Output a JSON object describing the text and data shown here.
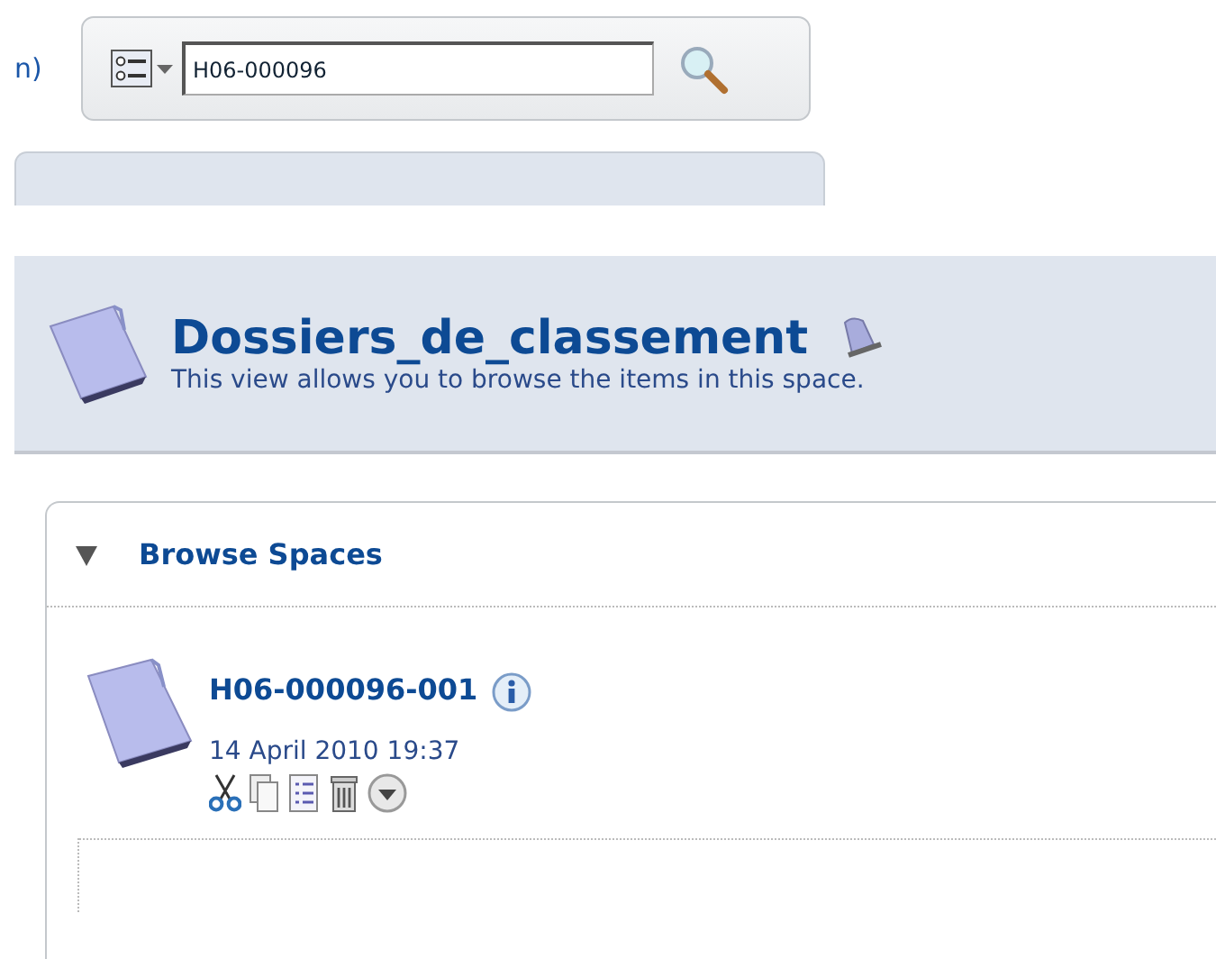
{
  "top_bar": {
    "cut_text": "n)",
    "search": {
      "value": "H06-000096"
    }
  },
  "space_header": {
    "title": "Dossiers_de_classement",
    "description": "This view allows you to browse the items in this space."
  },
  "browse_panel": {
    "title": "Browse Spaces",
    "expanded": true,
    "items": [
      {
        "name": "H06-000096-001",
        "date": "14 April 2010 19:37"
      }
    ]
  }
}
